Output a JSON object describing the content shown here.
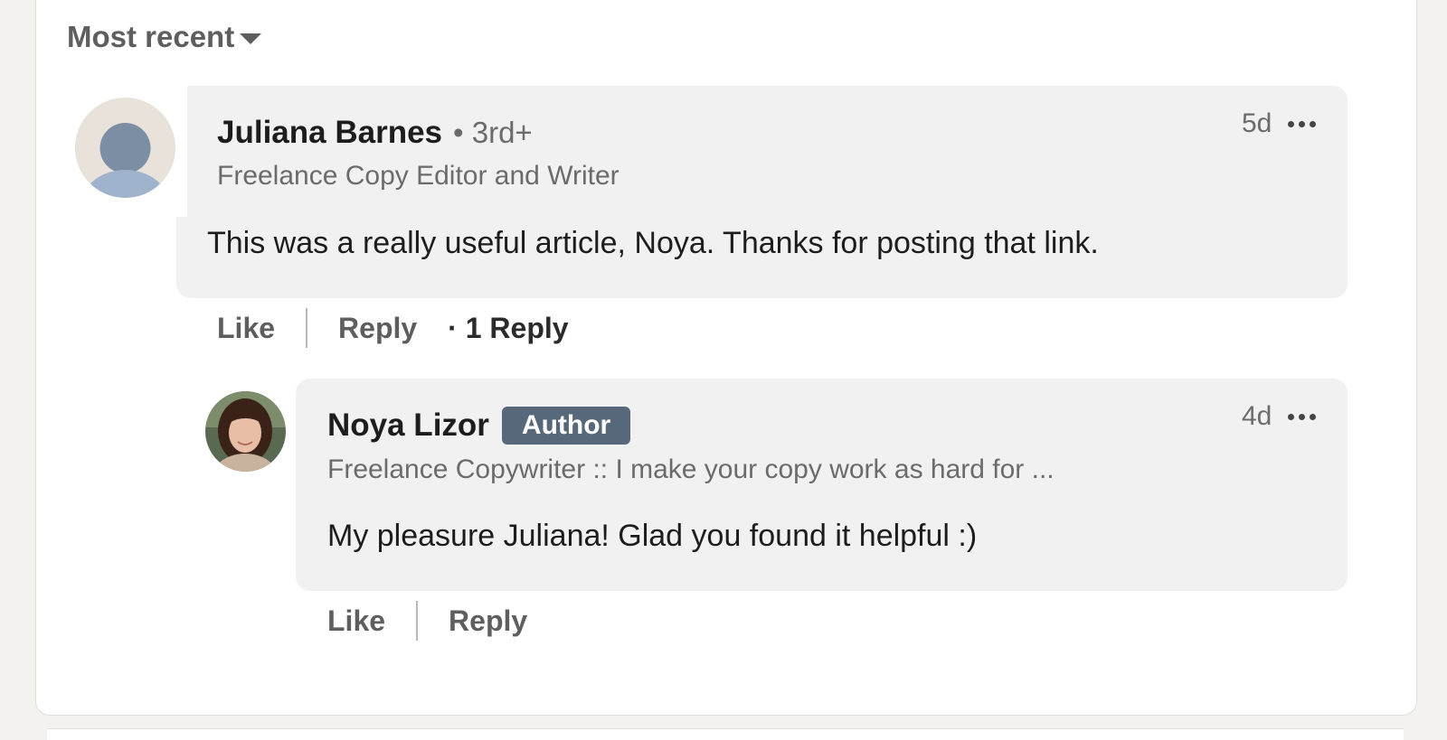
{
  "sort": {
    "label": "Most recent"
  },
  "comments": [
    {
      "name": "Juliana Barnes",
      "degree": "• 3rd+",
      "headline": "Freelance Copy Editor and Writer",
      "time": "5d",
      "text": "This was a really useful article, Noya. Thanks for posting that link.",
      "like_label": "Like",
      "reply_label": "Reply",
      "reply_count": "· 1 Reply"
    },
    {
      "name": "Noya Lizor",
      "badge": "Author",
      "headline": "Freelance Copywriter :: I make your copy work as hard for ...",
      "time": "4d",
      "text": "My pleasure Juliana! Glad you found it helpful :)",
      "like_label": "Like",
      "reply_label": "Reply"
    }
  ],
  "colors": {
    "bubble": "#f2f1f1",
    "badge": "#56687a",
    "page_bg": "#f4f2ee"
  }
}
